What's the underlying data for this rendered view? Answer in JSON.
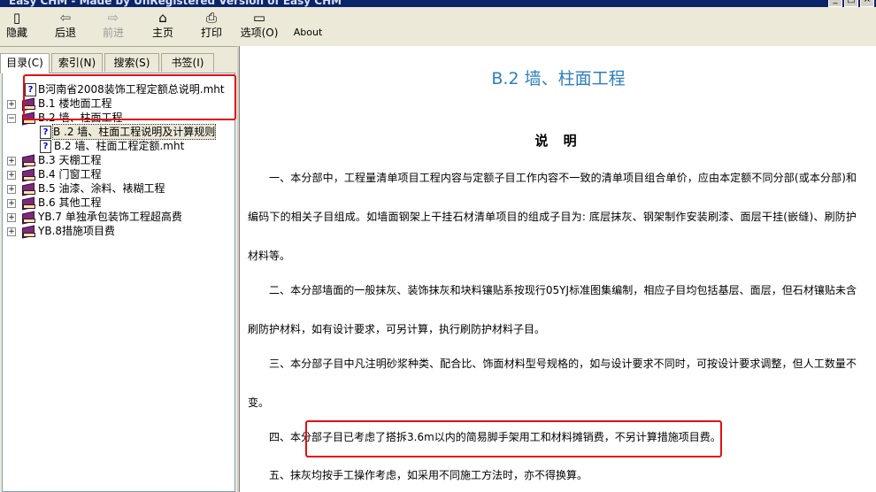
{
  "window": {
    "title": "Easy CHM - Made by UnRegistered Version of Easy CHM",
    "buttons": [
      "_",
      "□",
      "×"
    ]
  },
  "toolbar": [
    {
      "label": "隐藏",
      "icon": "hide-pane-icon",
      "glyph": "▯",
      "disabled": false
    },
    {
      "label": "后退",
      "icon": "back-arrow-icon",
      "glyph": "⇦",
      "disabled": false
    },
    {
      "label": "前进",
      "icon": "forward-arrow-icon",
      "glyph": "⇨",
      "disabled": true
    },
    {
      "label": "主页",
      "icon": "home-icon",
      "glyph": "⌂",
      "disabled": false
    },
    {
      "label": "打印",
      "icon": "printer-icon",
      "glyph": "⎙",
      "disabled": false
    },
    {
      "label": "选项(O)",
      "icon": "options-icon",
      "glyph": "▭",
      "disabled": false
    },
    {
      "label": "About",
      "icon": "about-icon",
      "glyph": "",
      "disabled": false
    }
  ],
  "tabs": [
    {
      "label": "目录(C)",
      "active": true
    },
    {
      "label": "索引(N)",
      "active": false
    },
    {
      "label": "搜索(S)",
      "active": false
    },
    {
      "label": "书签(I)",
      "active": false
    }
  ],
  "tree": [
    {
      "label": "B河南省2008装饰工程定额总说明.mht",
      "type": "page",
      "level": 0,
      "expander": ""
    },
    {
      "label": "B.1 楼地面工程",
      "type": "book",
      "level": 0,
      "expander": "+"
    },
    {
      "label": "B.2 墙、柱面工程",
      "type": "book-open",
      "level": 0,
      "expander": "−"
    },
    {
      "label": "B .2 墙、柱面工程说明及计算规则",
      "type": "page",
      "level": 1,
      "expander": "",
      "selected": true
    },
    {
      "label": "B.2 墙、柱面工程定额.mht",
      "type": "page",
      "level": 1,
      "expander": ""
    },
    {
      "label": "B.3 天棚工程",
      "type": "book",
      "level": 0,
      "expander": "+"
    },
    {
      "label": "B.4 门窗工程",
      "type": "book",
      "level": 0,
      "expander": "+"
    },
    {
      "label": "B.5 油漆、涂料、裱糊工程",
      "type": "book",
      "level": 0,
      "expander": "+"
    },
    {
      "label": "B.6 其他工程",
      "type": "book",
      "level": 0,
      "expander": "+"
    },
    {
      "label": "YB.7 单独承包装饰工程超高费",
      "type": "book",
      "level": 0,
      "expander": "+"
    },
    {
      "label": "YB.8措施项目费",
      "type": "book",
      "level": 0,
      "expander": "+"
    }
  ],
  "content": {
    "title": "B.2 墙、柱面工程",
    "heading": "说 明",
    "paragraphs": [
      "一、本分部中，工程量清单项目工程内容与定额子目工作内容不一致的清单项目组合单价，应由本定额不同分部(或本分部)和编码下的相关子目组成。如墙面钢架上干挂石材清单项目的组成子目为: 底层抹灰、钢架制作安装刷漆、面层干挂(嵌缝)、刷防护材料等。",
      "二、本分部墙面的一般抹灰、装饰抹灰和块料镶贴系按现行05YJ标准图集编制，相应子目均包括基层、面层，但石材镶贴未含刷防护材料，如有设计要求，可另计算，执行刷防护材料子目。",
      "三、本分部子目中凡注明砂浆种类、配合比、饰面材料型号规格的，如与设计要求不同时，可按设计要求调整，但人工数量不变。",
      "四、本分部子目已考虑了搭拆3.6m以内的简易脚手架用工和材料摊销费，不另计算措施项目费。",
      "五、抹灰均按手工操作考虑，如采用不同施工方法时，亦不得换算。"
    ]
  },
  "colors": {
    "title": "#2d7fbf",
    "highlight": "#e01010",
    "book": "#7b2a7c"
  }
}
